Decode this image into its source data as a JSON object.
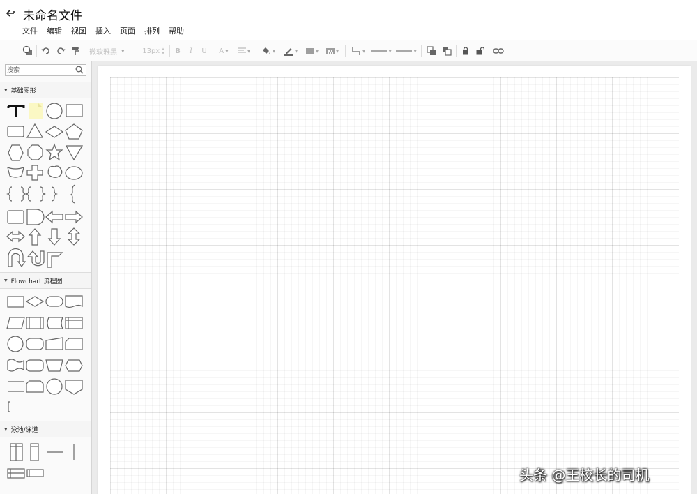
{
  "header": {
    "title": "未命名文件"
  },
  "menubar": {
    "items": [
      "文件",
      "编辑",
      "视图",
      "插入",
      "页面",
      "排列",
      "帮助"
    ]
  },
  "toolbar": {
    "font_family": "微软雅黑",
    "font_size": "13px",
    "bold": "B",
    "italic": "I",
    "underline": "U",
    "font_color": "A"
  },
  "sidebar": {
    "search_placeholder": "搜索",
    "sections": [
      {
        "label": "基础图形"
      },
      {
        "label": "Flowchart 流程图"
      },
      {
        "label": "泳池/泳道"
      }
    ]
  },
  "watermark": "头条 @王校长的司机",
  "colors": {
    "note_yellow": "#fbf8c4",
    "grid": "#dddddd",
    "canvas_bg": "#ebebeb"
  }
}
